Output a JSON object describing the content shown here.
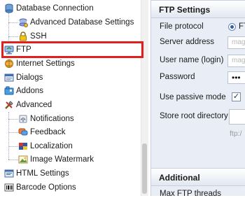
{
  "tree": {
    "items": [
      {
        "id": "database-connection",
        "label": "Database Connection",
        "icon": "database-icon"
      },
      {
        "id": "advanced-database-settings",
        "label": "Advanced Database Settings",
        "icon": "db-settings-icon"
      },
      {
        "id": "ssh",
        "label": "SSH",
        "icon": "lock-icon"
      },
      {
        "id": "ftp",
        "label": "FTP",
        "icon": "ftp-icon"
      },
      {
        "id": "internet-settings",
        "label": "Internet Settings",
        "icon": "internet-icon"
      },
      {
        "id": "dialogs",
        "label": "Dialogs",
        "icon": "dialogs-icon"
      },
      {
        "id": "addons",
        "label": "Addons",
        "icon": "addons-icon"
      },
      {
        "id": "advanced",
        "label": "Advanced",
        "icon": "tools-icon"
      },
      {
        "id": "notifications",
        "label": "Notifications",
        "icon": "notifications-icon"
      },
      {
        "id": "feedback",
        "label": "Feedback",
        "icon": "feedback-icon"
      },
      {
        "id": "localization",
        "label": "Localization",
        "icon": "localization-icon"
      },
      {
        "id": "image-watermark",
        "label": "Image Watermark",
        "icon": "image-icon"
      },
      {
        "id": "html-settings",
        "label": "HTML Settings",
        "icon": "html-icon"
      },
      {
        "id": "barcode-options",
        "label": "Barcode Options",
        "icon": "barcode-icon"
      }
    ],
    "selected": "ftp"
  },
  "ftp_settings": {
    "title": "FTP Settings",
    "protocol_label": "File protocol",
    "protocol_value": "FT",
    "server_label": "Server address",
    "server_value": "mag",
    "user_label": "User name (login)",
    "user_value": "mag",
    "password_label": "Password",
    "password_value": "•••",
    "passive_label": "Use passive mode",
    "passive_checked": true,
    "root_label": "Store root directory",
    "root_value": "",
    "url_hint": "ftp:/"
  },
  "additional": {
    "title": "Additional",
    "max_threads_label": "Max FTP threads"
  },
  "colors": {
    "highlight": "#e0201f",
    "panel_bg": "#e9eef6"
  }
}
